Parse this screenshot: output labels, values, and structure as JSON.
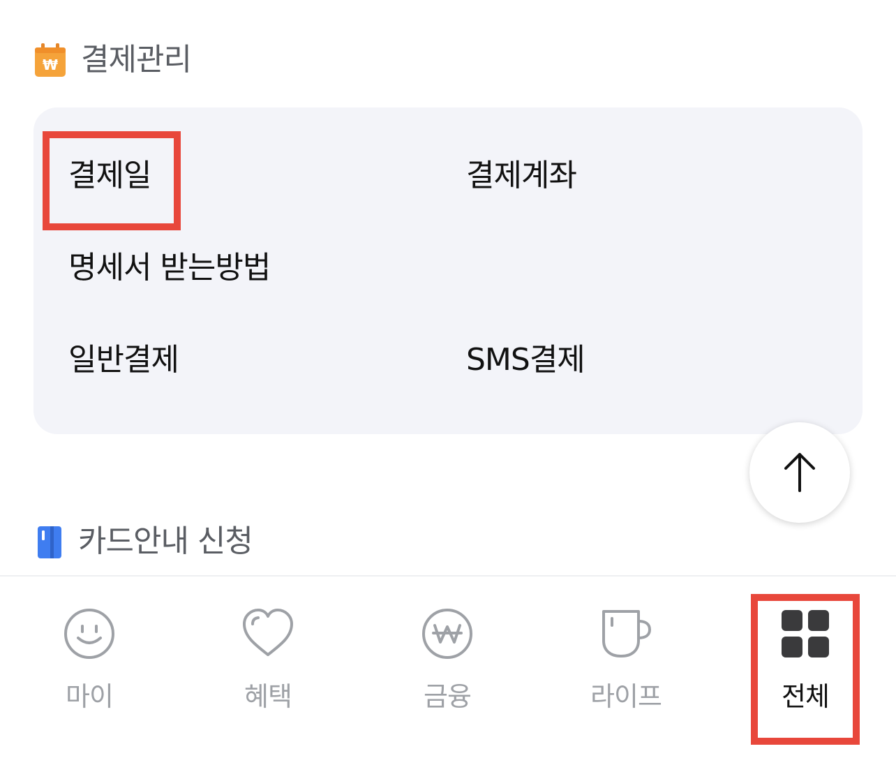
{
  "sections": {
    "payment": {
      "title": "결제관리",
      "icon": "calendar-won-icon",
      "items": [
        "결제일",
        "결제계좌",
        "명세서 받는방법",
        "일반결제",
        "SMS결제"
      ]
    },
    "card": {
      "title": "카드안내 신청",
      "icon": "card-icon"
    }
  },
  "bottom_nav": {
    "items": [
      {
        "label": "마이",
        "icon": "smiley-icon",
        "active": false
      },
      {
        "label": "혜택",
        "icon": "heart-icon",
        "active": false
      },
      {
        "label": "금융",
        "icon": "won-coin-icon",
        "active": false
      },
      {
        "label": "라이프",
        "icon": "mug-icon",
        "active": false
      },
      {
        "label": "전체",
        "icon": "grid-icon",
        "active": true
      }
    ]
  },
  "colors": {
    "highlight": "#e8473b",
    "panel_bg": "#f3f4f9",
    "calendar_icon": "#f5a33a",
    "card_icon": "#3f7df0",
    "inactive_nav": "#9ea1a6",
    "active_nav": "#111111"
  }
}
